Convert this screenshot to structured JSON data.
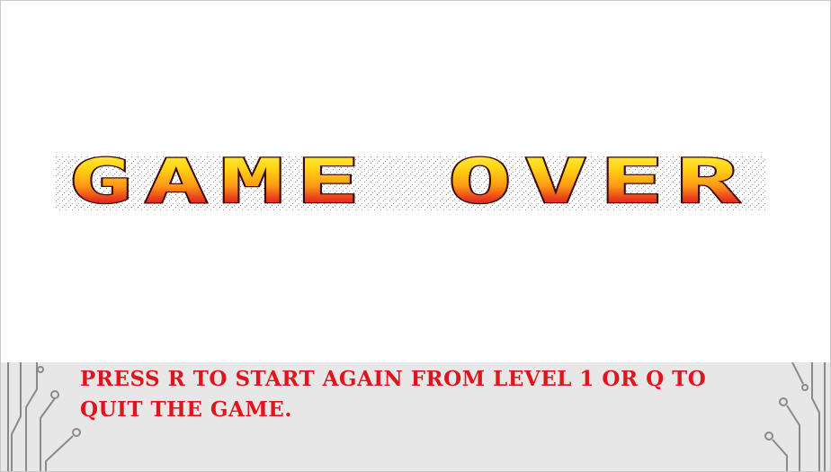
{
  "game": {
    "title": "GAME OVER",
    "message": "Press R to start again from level 1 or Q to quit the game."
  },
  "colors": {
    "background": "#ffffff",
    "panel": "#e7e7e7",
    "message_text": "#e0141c",
    "title_top": "#ffe414",
    "title_mid": "#ff9a14",
    "title_bottom": "#d8101c",
    "title_outline": "#3a0a0a",
    "circuit_lines": "#8a8a8a"
  },
  "icons": {
    "left_decoration": "circuit-lines-icon",
    "right_decoration": "circuit-lines-icon"
  }
}
